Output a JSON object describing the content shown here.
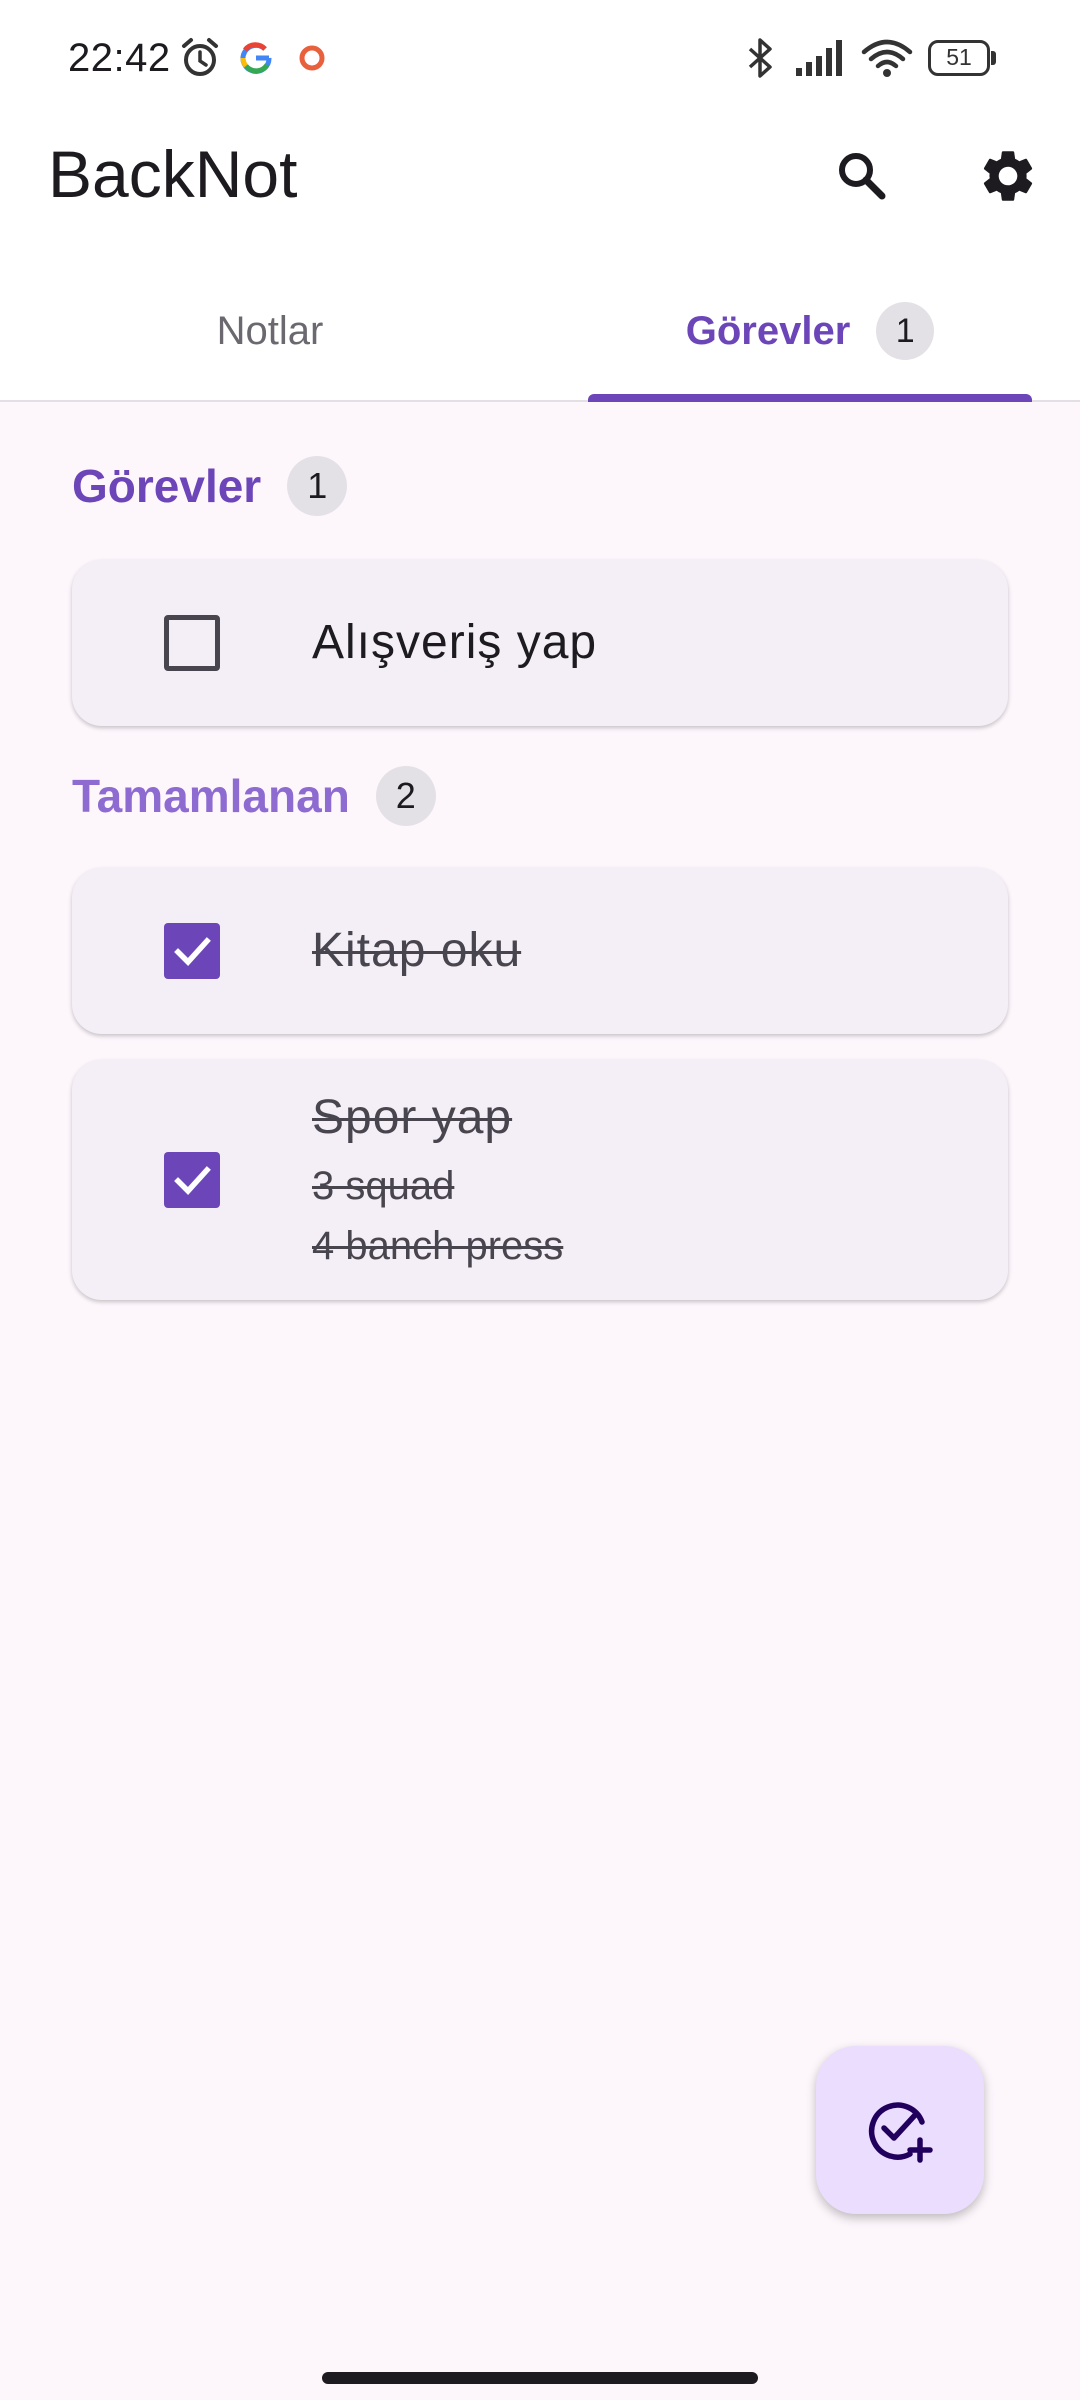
{
  "status_bar": {
    "time": "22:42",
    "battery": "51",
    "icons": [
      "alarm-icon",
      "google-icon",
      "notification-dot-icon",
      "bluetooth-icon",
      "signal-icon",
      "wifi-icon",
      "battery-icon"
    ]
  },
  "app_bar": {
    "title": "BackNot",
    "actions": [
      "search-icon",
      "settings-icon"
    ]
  },
  "tabs": [
    {
      "label": "Notlar",
      "selected": false
    },
    {
      "label": "Görevler",
      "badge": "1",
      "selected": true
    }
  ],
  "sections": {
    "pending": {
      "title": "Görevler",
      "count": "1",
      "tasks": [
        {
          "title": "Alışveriş yap",
          "checked": false
        }
      ]
    },
    "completed": {
      "title": "Tamamlanan",
      "count": "2",
      "tasks": [
        {
          "title": "Kitap oku",
          "checked": true
        },
        {
          "title": "Spor yap",
          "lines": [
            "3 squad",
            "4 banch press"
          ],
          "checked": true
        }
      ]
    }
  },
  "fab": {
    "icon": "add-task-icon"
  },
  "colors": {
    "accent": "#6c45b8",
    "accent_light": "#8d6bd1",
    "background": "#fdf7fc",
    "card": "#f4eff7",
    "fab": "#eaddfe"
  }
}
